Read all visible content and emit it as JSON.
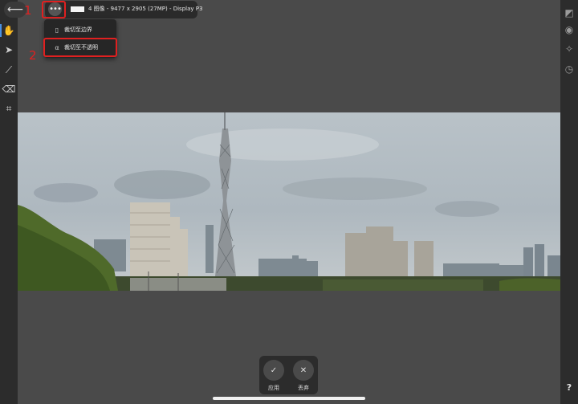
{
  "header": {
    "back_glyph": "⟵",
    "more_glyph": "•••",
    "document_info": "4 图像 - 9477 x 2905 (27MP) - Display P3"
  },
  "annotations": {
    "label_1": "1",
    "label_2": "2"
  },
  "menu": {
    "items": [
      {
        "icon": "crop-to-bounds-icon",
        "glyph": "▯",
        "label": "裁切至边界"
      },
      {
        "icon": "crop-to-opaque-icon",
        "glyph": "α",
        "label": "裁切至不透明"
      }
    ]
  },
  "left_toolbar": {
    "tools": [
      {
        "icon": "hand-icon",
        "glyph": "✋"
      },
      {
        "icon": "move-arrow-icon",
        "glyph": "➤"
      },
      {
        "icon": "brush-icon",
        "glyph": "⟋"
      },
      {
        "icon": "eraser-icon",
        "glyph": "⌫"
      },
      {
        "icon": "crop-icon",
        "glyph": "⌗"
      }
    ]
  },
  "right_toolbar": {
    "tools": [
      {
        "icon": "image-adjust-icon",
        "glyph": "◩"
      },
      {
        "icon": "camera-icon",
        "glyph": "◉"
      },
      {
        "icon": "sparkle-icon",
        "glyph": "✧"
      },
      {
        "icon": "history-clock-icon",
        "glyph": "◷"
      }
    ],
    "help_label": "?"
  },
  "actions": {
    "apply_glyph": "✓",
    "apply_label": "应用",
    "discard_glyph": "✕",
    "discard_label": "丢弃"
  },
  "colors": {
    "annotation": "#e02020",
    "background": "#4a4a4a",
    "toolbar": "#2c2c2c",
    "accent": "#4a90e2"
  }
}
